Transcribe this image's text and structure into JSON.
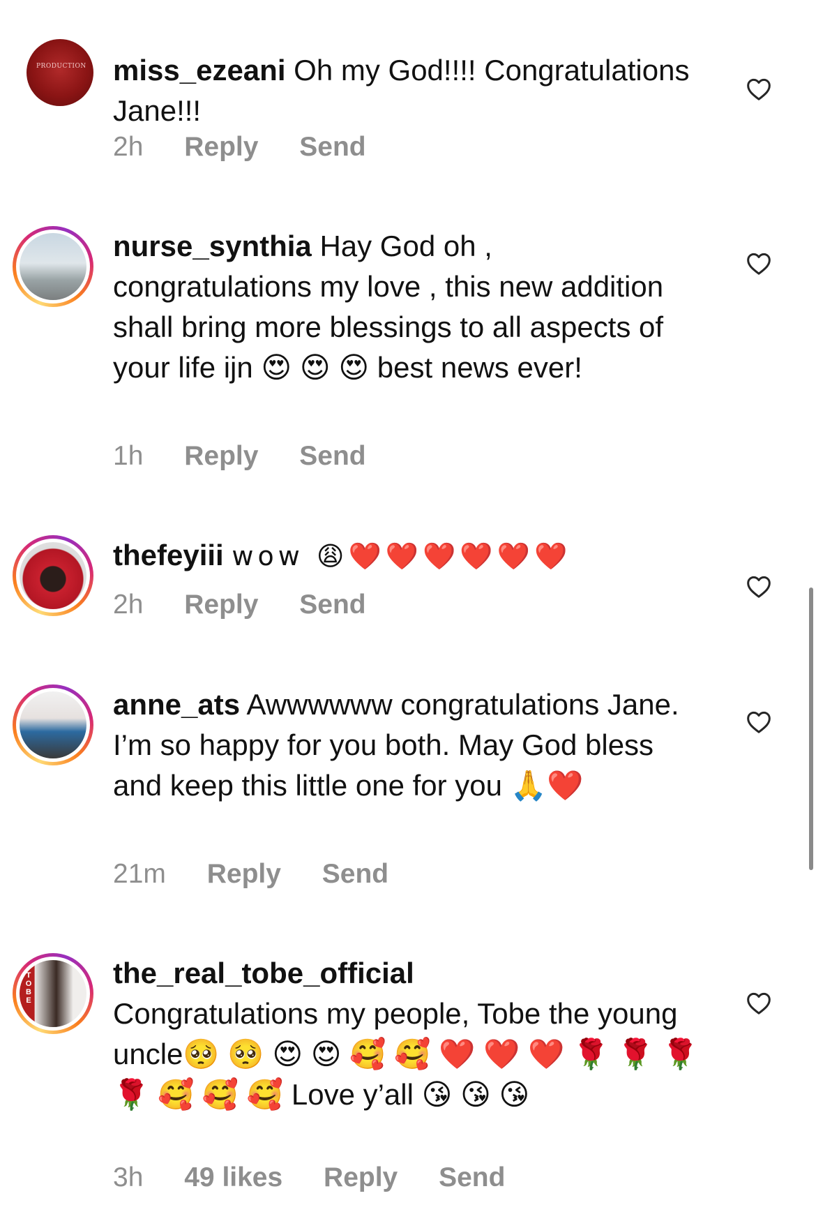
{
  "comments": [
    {
      "username": "miss_ezeani",
      "text": "Oh my God!!!! Congratulations Jane!!!",
      "time": "2h",
      "likes": "",
      "reply_label": "Reply",
      "send_label": "Send",
      "avatar_logo_text": "PRODUCTION"
    },
    {
      "username": "nurse_synthia",
      "text": "Hay God oh , congratulations my love , this new addition shall bring more blessings to all aspects of your life ijn 😍 😍 😍 best news ever!",
      "time": "1h",
      "likes": "",
      "reply_label": "Reply",
      "send_label": "Send"
    },
    {
      "username": "thefeyiii",
      "text": "wow 😩❤️❤️❤️❤️❤️❤️",
      "time": "2h",
      "likes": "",
      "reply_label": "Reply",
      "send_label": "Send"
    },
    {
      "username": "anne_ats",
      "text": "Awwwwww congratulations Jane. I’m so happy for you both. May God bless and keep this little one for you 🙏❤️",
      "time": "21m",
      "likes": "",
      "reply_label": "Reply",
      "send_label": "Send"
    },
    {
      "username": "the_real_tobe_official",
      "text": "Congratulations my people, Tobe the young uncle🥺 🥺 😍 😍 🥰 🥰 ❤️ ❤️ ❤️ 🌹 🌹 🌹 🌹 🥰 🥰 🥰 Love y’all 😘 😘 😘",
      "time": "3h",
      "likes": "49 likes",
      "reply_label": "Reply",
      "send_label": "Send",
      "avatar_badge_text": "TOBE"
    }
  ],
  "icons": {
    "like": "heart-outline-icon"
  },
  "colors": {
    "text": "#111111",
    "meta": "#8e8e8e",
    "story_ring": [
      "#feda75",
      "#fa7e1e",
      "#d62976",
      "#962fbf"
    ]
  }
}
